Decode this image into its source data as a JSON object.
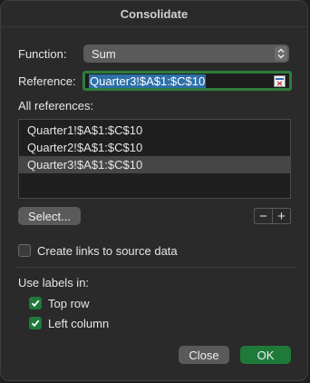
{
  "dialog": {
    "title": "Consolidate",
    "function_label": "Function:",
    "function_value": "Sum",
    "reference_label": "Reference:",
    "reference_value": "Quarter3!$A$1:$C$10",
    "all_references_label": "All references:",
    "references": [
      "Quarter1!$A$1:$C$10",
      "Quarter2!$A$1:$C$10",
      "Quarter3!$A$1:$C$10"
    ],
    "selected_reference_index": 2,
    "select_button": "Select...",
    "add_symbol": "+",
    "remove_symbol": "−",
    "create_links_label": "Create links to source data",
    "create_links_checked": false,
    "use_labels_label": "Use labels in:",
    "top_row_label": "Top row",
    "top_row_checked": true,
    "left_column_label": "Left column",
    "left_column_checked": true,
    "close_button": "Close",
    "ok_button": "OK",
    "accent_color": "#1f7a3a",
    "selection_color": "#2d6fa8"
  }
}
